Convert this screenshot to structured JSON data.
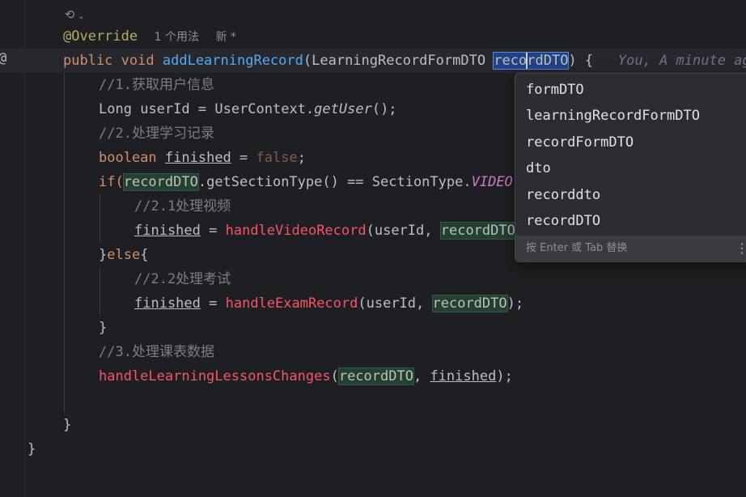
{
  "hint_row": {
    "icon": "vcs-history-icon",
    "usages": "1 个用法",
    "new_label": "新 *"
  },
  "code": {
    "annotation": "@Override",
    "sig_public": "public",
    "sig_void": "void",
    "sig_method": "addLearningRecord",
    "sig_open": "(",
    "sig_type": "LearningRecordFormDTO",
    "sig_param_a": "reco",
    "sig_param_b": "rdDTO",
    "sig_close": ") {",
    "inlay": "You, A minute ago",
    "c1": "//1.获取用户信息",
    "l2_type": "Long",
    "l2_var": "userId",
    "l2_eq": " = ",
    "l2_cls": "UserContext.",
    "l2_call": "getUser",
    "l2_end": "();",
    "c2": "//2.处理学习记录",
    "l4_kw": "boolean",
    "l4_var": "finished",
    "l4_eq": " = ",
    "l4_val": "false",
    "l4_end": ";",
    "l5_if": "if(",
    "l5_dto": "recordDTO",
    "l5_call": ".getSectionType() == SectionType.",
    "l5_const": "VIDEO",
    "c21": "//2.1处理视频",
    "l7_var": "finished",
    "l7_eq": " = ",
    "l7_call": "handleVideoRecord",
    "l7_args": "(userId, ",
    "l7_dto": "recordDTO",
    "l8_open": "}",
    "l8_kw": "else",
    "l8_brace": "{",
    "c22": "//2.2处理考试",
    "l10_var": "finished",
    "l10_eq": " = ",
    "l10_call": "handleExamRecord",
    "l10_args": "(userId, ",
    "l10_dto": "recordDTO",
    "l10_end": ");",
    "l11": "}",
    "c3": "//3.处理课表数据",
    "l13_call": "handleLearningLessonsChanges",
    "l13_open": "(",
    "l13_dto": "recordDTO",
    "l13_sep": ", ",
    "l13_var": "finished",
    "l13_end": ");",
    "l15": "}",
    "l16": "}"
  },
  "completion": {
    "items": [
      "formDTO",
      "learningRecordFormDTO",
      "recordFormDTO",
      "dto",
      "recorddto",
      "recordDTO"
    ],
    "footer": "按 Enter 或 Tab 替换",
    "more": "⋮"
  }
}
